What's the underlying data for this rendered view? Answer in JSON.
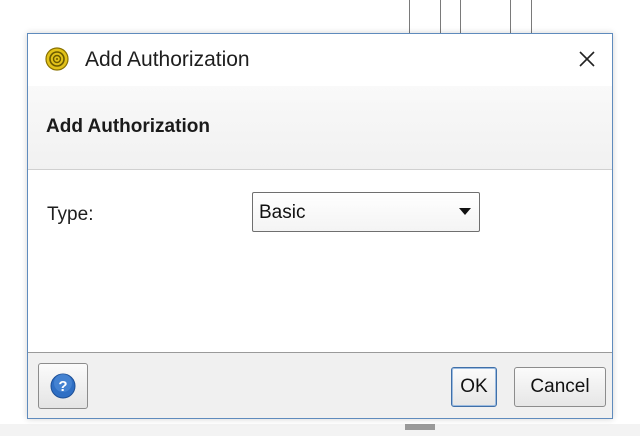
{
  "window": {
    "title": "Add Authorization",
    "icon": "app-gear-icon"
  },
  "header": {
    "title": "Add Authorization"
  },
  "form": {
    "type_label": "Type:",
    "type_value": "Basic"
  },
  "footer": {
    "help_icon": "help-icon",
    "ok_label": "OK",
    "cancel_label": "Cancel"
  },
  "colors": {
    "accent": "#3f6fa8",
    "help_blue": "#2f6fc4",
    "app_icon_yellow": "#d8b400"
  }
}
